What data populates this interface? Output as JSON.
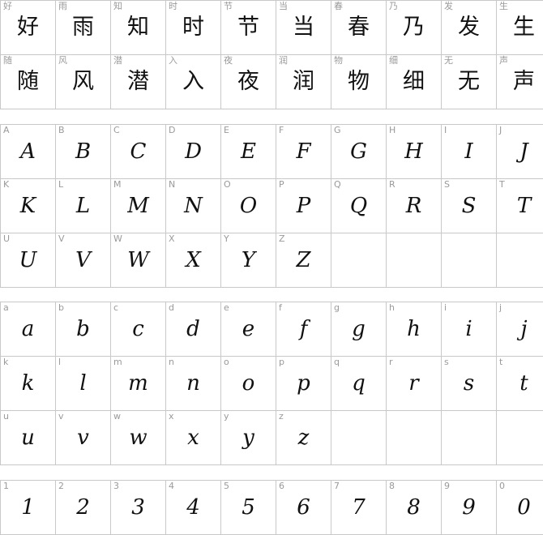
{
  "sections": [
    {
      "id": "hanzi",
      "rows": [
        [
          "好",
          "雨",
          "知",
          "时",
          "节",
          "当",
          "春",
          "乃",
          "发",
          "生"
        ],
        [
          "随",
          "风",
          "潜",
          "入",
          "夜",
          "润",
          "物",
          "细",
          "无",
          "声"
        ]
      ]
    },
    {
      "id": "upper",
      "rows": [
        [
          "A",
          "B",
          "C",
          "D",
          "E",
          "F",
          "G",
          "H",
          "I",
          "J"
        ],
        [
          "K",
          "L",
          "M",
          "N",
          "O",
          "P",
          "Q",
          "R",
          "S",
          "T"
        ],
        [
          "U",
          "V",
          "W",
          "X",
          "Y",
          "Z",
          "",
          "",
          "",
          ""
        ]
      ]
    },
    {
      "id": "lower",
      "rows": [
        [
          "a",
          "b",
          "c",
          "d",
          "e",
          "f",
          "g",
          "h",
          "i",
          "j"
        ],
        [
          "k",
          "l",
          "m",
          "n",
          "o",
          "p",
          "q",
          "r",
          "s",
          "t"
        ],
        [
          "u",
          "v",
          "w",
          "x",
          "y",
          "z",
          "",
          "",
          "",
          ""
        ]
      ]
    },
    {
      "id": "digits",
      "rows": [
        [
          "1",
          "2",
          "3",
          "4",
          "5",
          "6",
          "7",
          "8",
          "9",
          "0"
        ]
      ]
    }
  ]
}
